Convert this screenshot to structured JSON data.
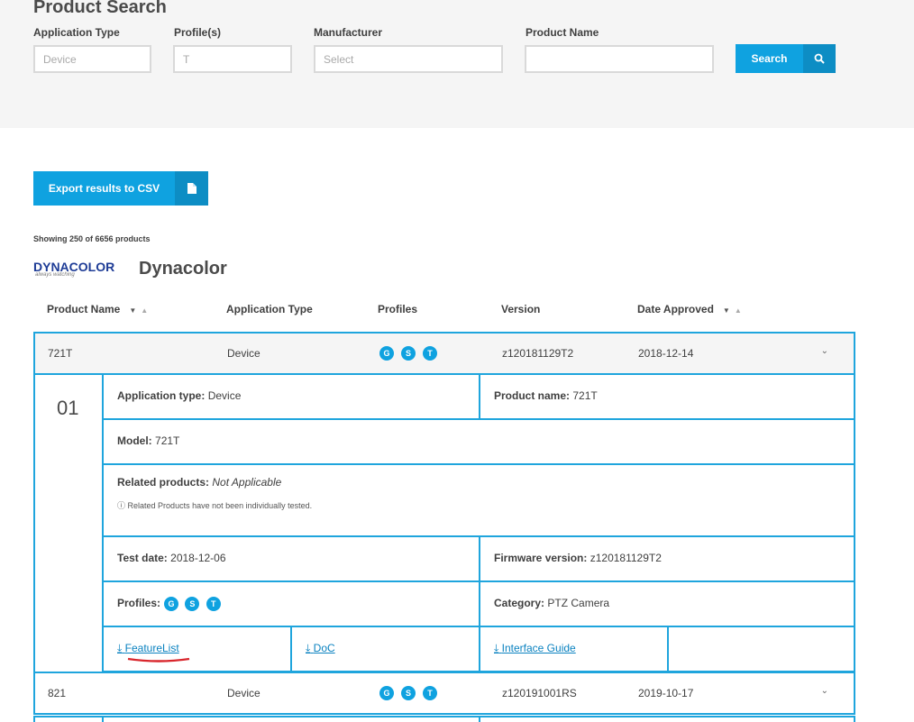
{
  "search": {
    "title": "Product Search",
    "fields": {
      "application_type": {
        "label": "Application Type",
        "value": "Device"
      },
      "profiles": {
        "label": "Profile(s)",
        "value": "T"
      },
      "manufacturer": {
        "label": "Manufacturer",
        "placeholder": "Select"
      },
      "product_name": {
        "label": "Product Name",
        "value": ""
      }
    },
    "button_label": "Search",
    "button_icon": "search-icon"
  },
  "export": {
    "label": "Export results to CSV",
    "icon": "file-icon"
  },
  "results": {
    "showing": "Showing 250 of 6656 products",
    "manufacturer_name": "Dynacolor",
    "logo_text": "DYNACOLOR",
    "logo_sub": "always watching"
  },
  "columns": [
    "Product Name",
    "Application Type",
    "Profiles",
    "Version",
    "Date Approved"
  ],
  "rows": [
    {
      "name": "721T",
      "type": "Device",
      "profiles": [
        "G",
        "S",
        "T"
      ],
      "version": "z120181129T2",
      "date": "2018-12-14"
    },
    {
      "name": "821",
      "type": "Device",
      "profiles": [
        "G",
        "S",
        "T"
      ],
      "version": "z120191001RS",
      "date": "2019-10-17"
    }
  ],
  "detail": {
    "index": "01",
    "application_type_label": "Application type:",
    "application_type": "Device",
    "product_name_label": "Product name:",
    "product_name": "721T",
    "model_label": "Model:",
    "model": "721T",
    "related_label": "Related products:",
    "related": "Not Applicable",
    "related_note": "Related Products have not been individually tested.",
    "test_date_label": "Test date:",
    "test_date": "2018-12-06",
    "firmware_label": "Firmware version:",
    "firmware": "z120181129T2",
    "profiles_label": "Profiles:",
    "profiles": [
      "G",
      "S",
      "T"
    ],
    "category_label": "Category:",
    "category": "PTZ Camera",
    "links": [
      "FeatureList",
      "DoC",
      "Interface Guide"
    ]
  },
  "colors": {
    "accent": "#0fa2e0",
    "border": "#1fa5dd",
    "annotation": "#d9262c"
  }
}
